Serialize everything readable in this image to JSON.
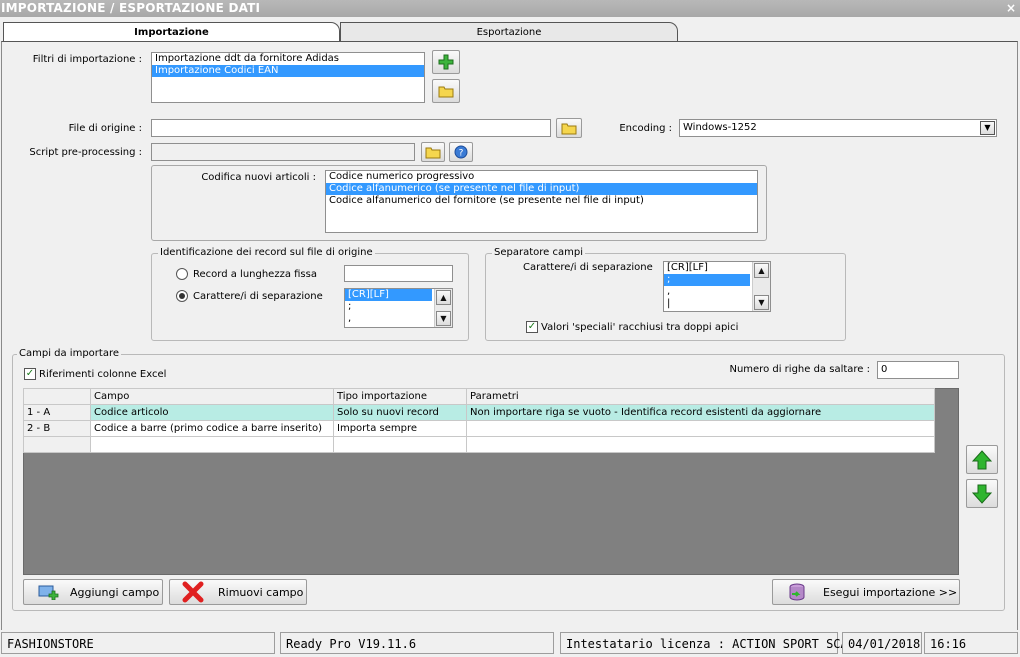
{
  "window": {
    "title": "IMPORTAZIONE / ESPORTAZIONE DATI",
    "close_glyph": "×"
  },
  "tabs": [
    {
      "label": "Importazione",
      "active": true
    },
    {
      "label": "Esportazione",
      "active": false
    }
  ],
  "filters": {
    "label": "Filtri di importazione :",
    "items": [
      {
        "label": "Importazione ddt da fornitore Adidas",
        "selected": false
      },
      {
        "label": "Importazione Codici EAN",
        "selected": true
      }
    ],
    "add_icon": "plus-icon",
    "open_icon": "folder-icon"
  },
  "source_file": {
    "label": "File di origine :",
    "value": ""
  },
  "encoding": {
    "label": "Encoding :",
    "value": "Windows-1252"
  },
  "preprocess": {
    "label": "Script pre-processing :",
    "value": ""
  },
  "codifica": {
    "label": "Codifica nuovi articoli :",
    "items": [
      {
        "label": "Codice numerico progressivo",
        "selected": false
      },
      {
        "label": "Codice alfanumerico (se presente nel file di input)",
        "selected": true
      },
      {
        "label": "Codice alfanumerico del fornitore (se presente nel file di input)",
        "selected": false
      }
    ]
  },
  "record_id": {
    "legend": "Identificazione dei record sul file di origine",
    "fixed_label": "Record a lunghezza fissa",
    "fixed_value": "",
    "sep_label": "Carattere/i di separazione",
    "selected": "sep",
    "sep_items": [
      "[CR][LF]",
      ";",
      ","
    ]
  },
  "field_sep": {
    "legend": "Separatore campi",
    "label": "Carattere/i di separazione",
    "items": [
      "[CR][LF]",
      ";",
      ",",
      "|"
    ],
    "quotes_label": "Valori 'speciali' racchiusi tra doppi apici",
    "quotes_checked": true
  },
  "fields": {
    "legend": "Campi da importare",
    "excel_label": "Riferimenti colonne Excel",
    "excel_checked": true,
    "skip_label": "Numero di righe da saltare :",
    "skip_value": "0",
    "columns": [
      "Campo",
      "Tipo importazione",
      "Parametri"
    ],
    "rows": [
      {
        "id": "1 - A",
        "campo": "Codice articolo",
        "tipo": "Solo su nuovi record",
        "parametri": "Non importare riga se vuoto - Identifica record esistenti da aggiornare"
      },
      {
        "id": "2 - B",
        "campo": "Codice a barre (primo codice a barre inserito)",
        "tipo": "Importa sempre",
        "parametri": ""
      }
    ]
  },
  "buttons": {
    "add_field": "Aggiungi campo",
    "remove_field": "Rimuovi campo",
    "run_import": "Esegui importazione >>"
  },
  "statusbar": {
    "company": "FASHIONSTORE",
    "version": "Ready Pro V19.11.6",
    "license": "Intestatario licenza : ACTION SPORT SCARL",
    "date": "04/01/2018",
    "time": "16:16"
  },
  "colors": {
    "selection": "#3399ff",
    "row_highlight": "#b8ece4",
    "grid_empty": "#808080",
    "arrow_green": "#2fb52f"
  }
}
